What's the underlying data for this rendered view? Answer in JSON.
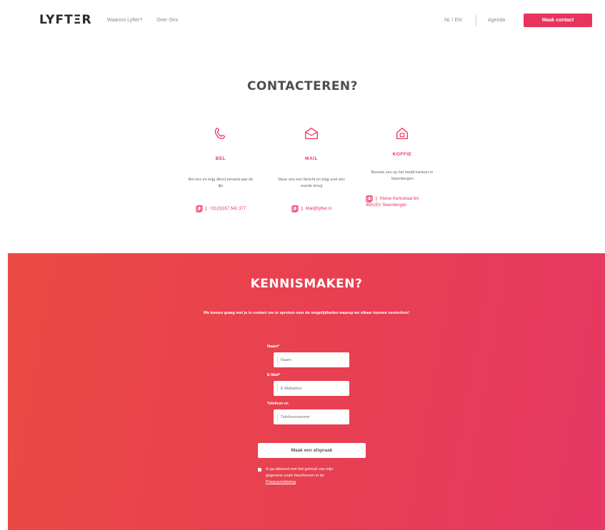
{
  "header": {
    "logo": "LYFTΞR",
    "nav": [
      "Waarom Lyfter?",
      "Over Ons"
    ],
    "lang": "NL / EN",
    "agenda": "Agenda",
    "cta": "Maak contact"
  },
  "contact": {
    "title": "CONTACTEREN?",
    "columns": [
      {
        "icon": "phone-icon",
        "title": "BEL",
        "desc": "Bel ons en krijg direct iemand aan de lijn",
        "link": "+31(0)167 541 377"
      },
      {
        "icon": "envelope-icon",
        "title": "MAIL",
        "desc": "Stuur ons een bericht en krijg snel een reactie terug",
        "link": "Mail@lyfter.nl"
      },
      {
        "icon": "house-icon",
        "title": "KOFFIE",
        "desc": "Bezoek ons op het hoofd kantoor in Steenbergen",
        "link_line1": "Kleine Kerkstraat 6A",
        "link_line2": "4651EV Steenbergen"
      }
    ]
  },
  "meet": {
    "title": "KENNISMAKEN?",
    "subtitle": "We komen graag met je in contact om te spreken over de mogelijkheden waarop we elkaar kunnen versterken!",
    "fields": [
      {
        "label": "Naam*",
        "placeholder": "Naam"
      },
      {
        "label": "E-Mail*",
        "placeholder": "E-Mailadres"
      },
      {
        "label": "Telefoon nr.",
        "placeholder": "Telefoonnummer"
      }
    ],
    "submit": "Maak een afspraak",
    "consent_text": "Ik ga akkoord met het gebruik van mijn gegevens zoals beschreven in de",
    "consent_link": "Privacyverklaring"
  },
  "colors": {
    "accent": "#e8335f",
    "pink_start": "#ea4a43",
    "pink_end": "#e63863"
  }
}
